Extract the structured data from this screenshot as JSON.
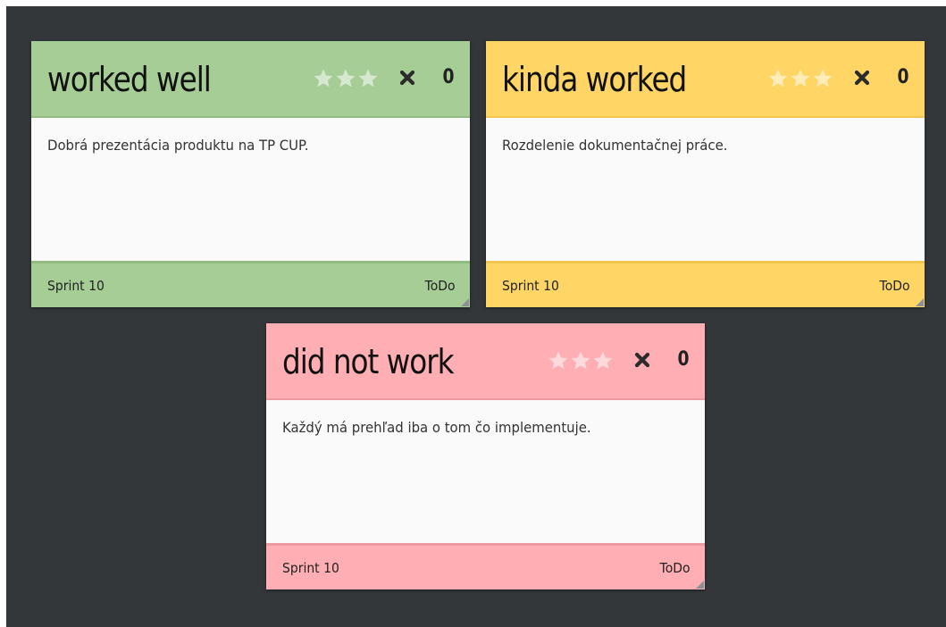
{
  "board": {
    "background_color": "#33373a"
  },
  "cards": [
    {
      "title": "worked well",
      "body": "Dobrá prezentácia produktu na TP CUP.",
      "votes": "0",
      "sprint": "Sprint 10",
      "status": "ToDo",
      "color": "#a5cd95",
      "rating": 0
    },
    {
      "title": "kinda worked",
      "body": "Rozdelenie dokumentačnej práce.",
      "votes": "0",
      "sprint": "Sprint 10",
      "status": "ToDo",
      "color": "#ffd665",
      "rating": 0
    },
    {
      "title": "did not work",
      "body": "Každý má prehľad iba o tom čo implementuje.",
      "votes": "0",
      "sprint": "Sprint 10",
      "status": "ToDo",
      "color": "#ffaeb3",
      "rating": 0
    }
  ],
  "icons": {
    "star": "star-icon",
    "delete": "close-icon",
    "resize": "resize-grip-icon"
  }
}
